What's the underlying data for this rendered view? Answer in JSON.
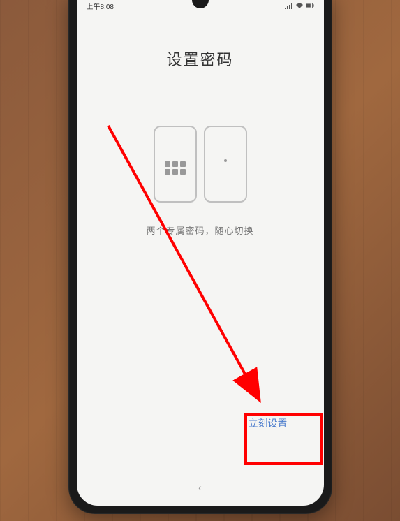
{
  "status_bar": {
    "time": "上午8:08"
  },
  "page": {
    "title": "设置密码",
    "description": "两个专属密码，随心切换"
  },
  "action": {
    "setup_now": "立刻设置"
  },
  "nav": {
    "back_symbol": "‹"
  }
}
